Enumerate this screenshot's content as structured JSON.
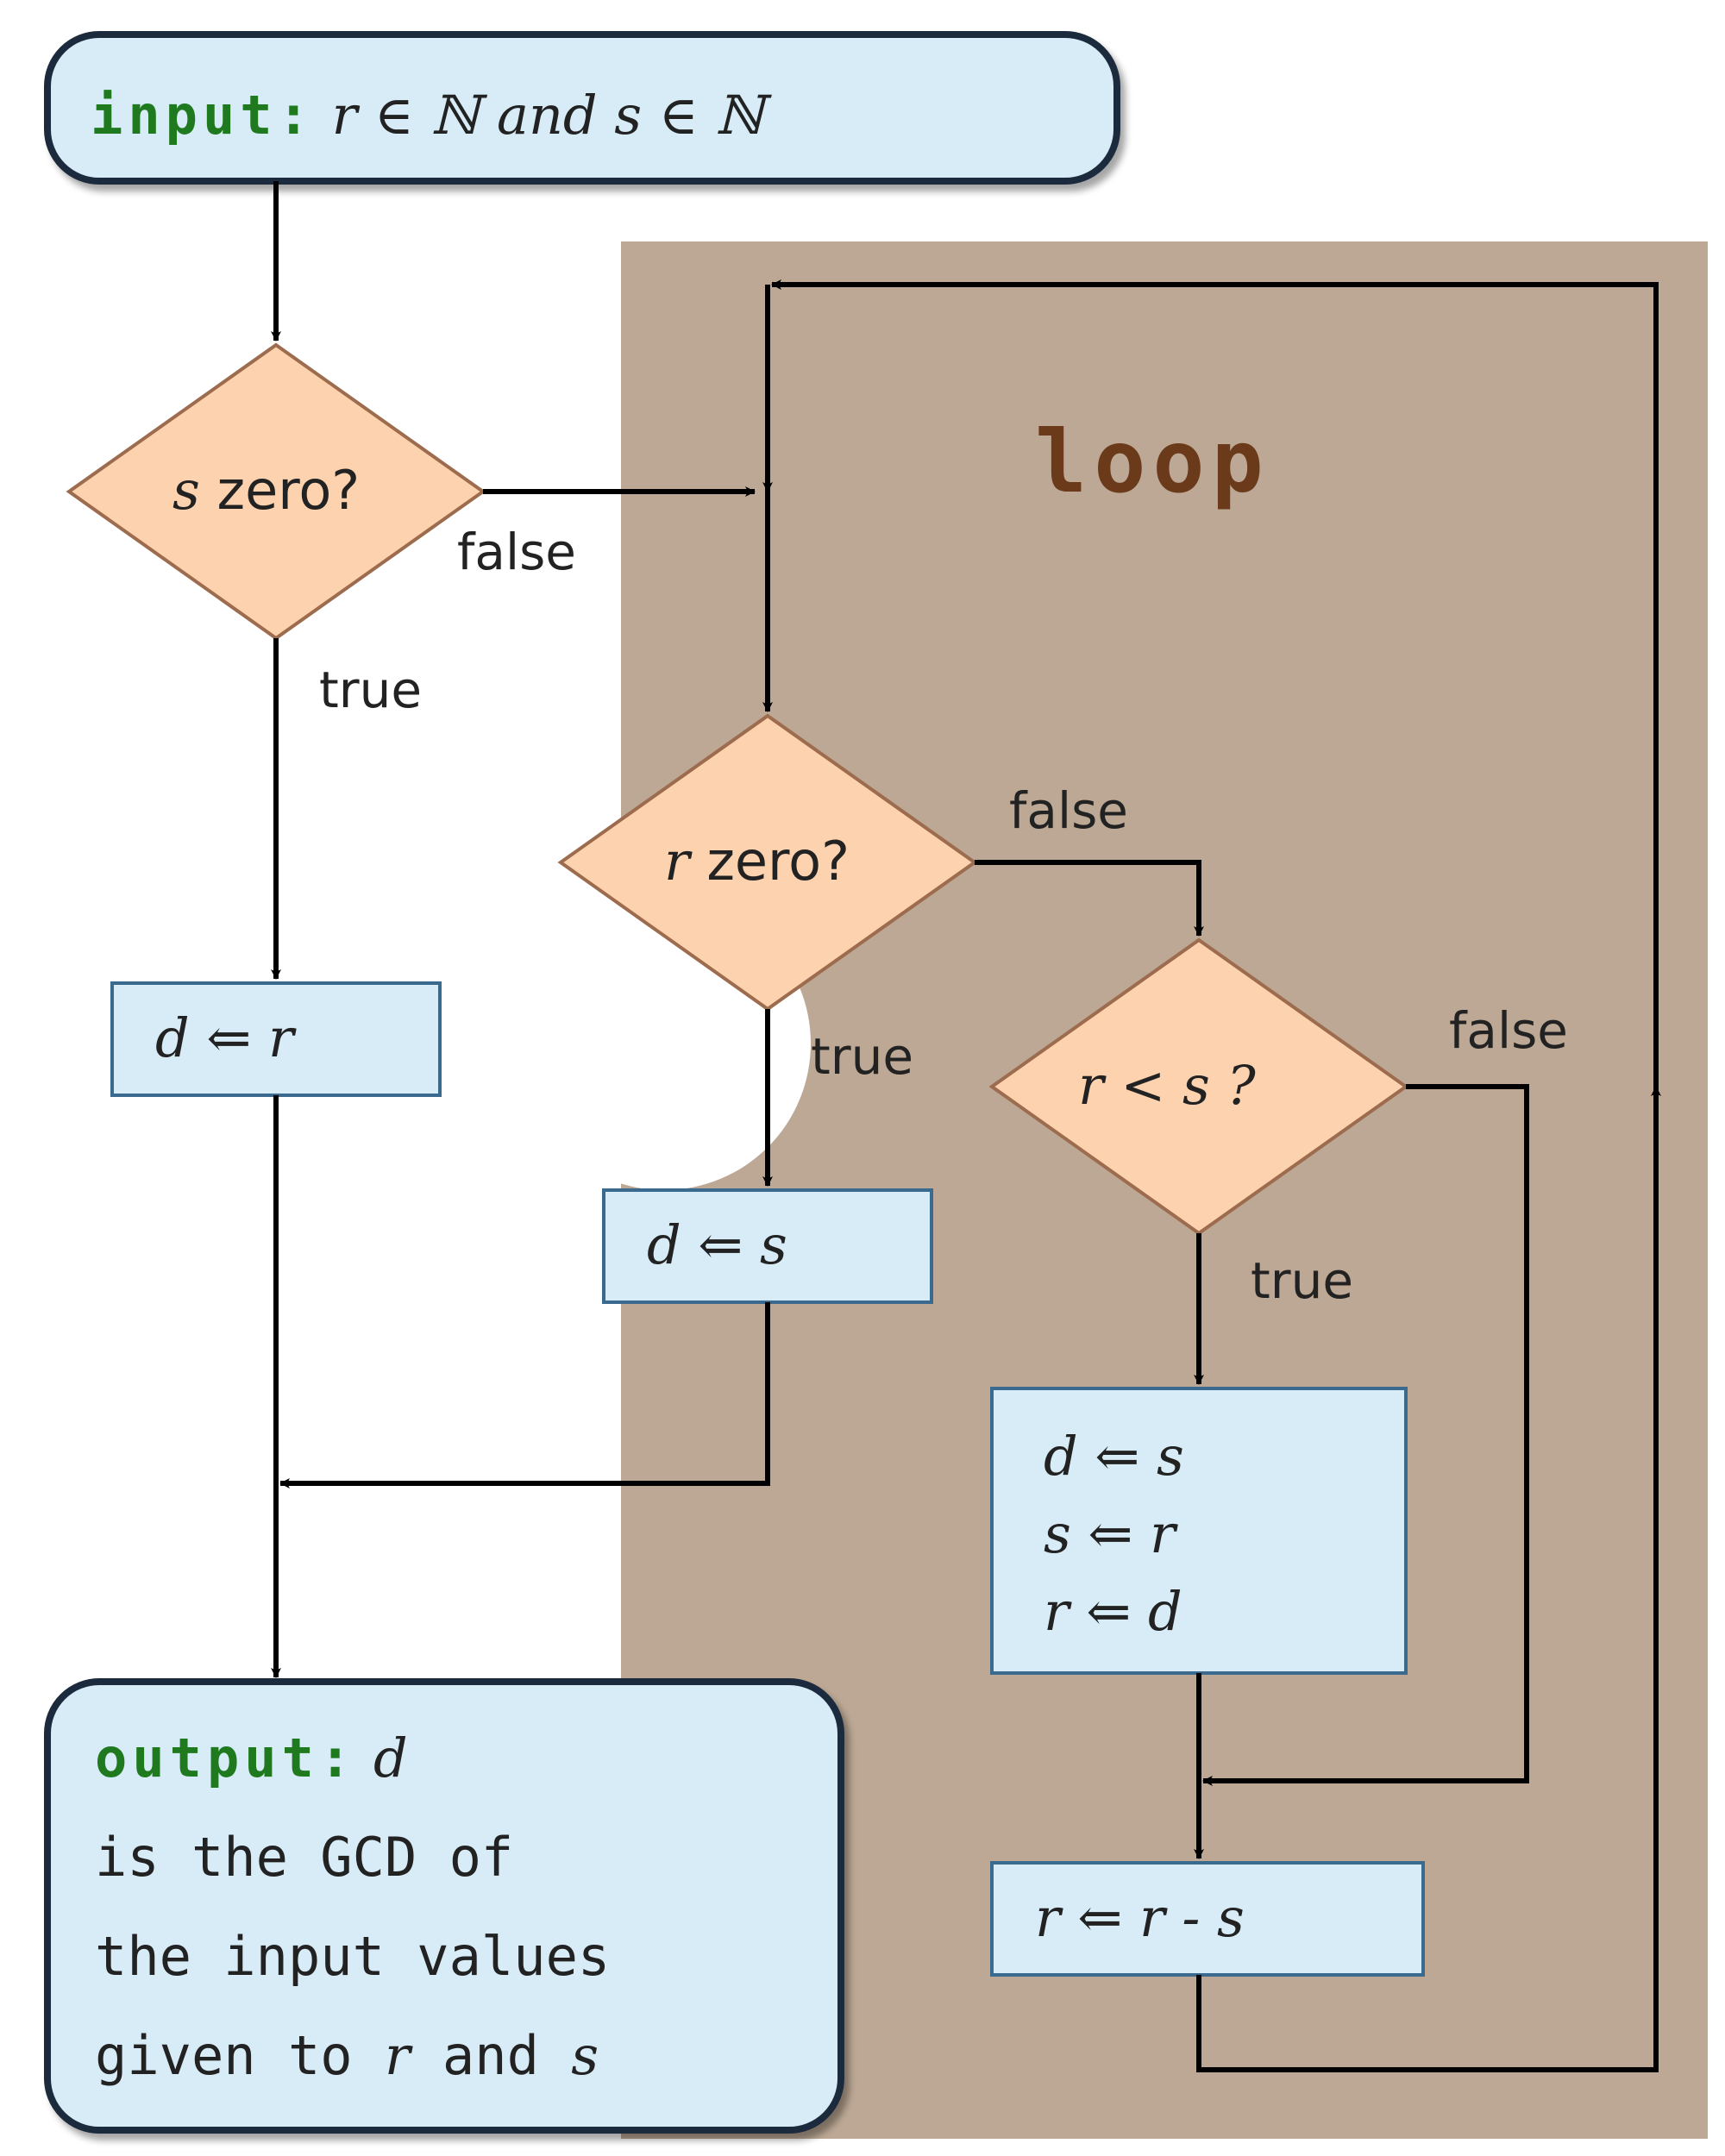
{
  "diagram": {
    "input": {
      "keyword": "input:",
      "text": " r ∈ ℕ  and  s ∈ ℕ"
    },
    "output": {
      "keyword": "output:",
      "var": " d",
      "line2": "is  the  GCD  of",
      "line3": "the  input  values",
      "line4": "given to  r  and  s"
    },
    "loop_label": "loop",
    "decisions": {
      "s_zero": {
        "text": "s zero?",
        "true": "true",
        "false": "false"
      },
      "r_zero": {
        "text": "r zero?",
        "true": "true",
        "false": "false"
      },
      "r_lt_s": {
        "text": "r < s ?",
        "true": "true",
        "false": "false"
      }
    },
    "processes": {
      "d_r": "d ⇐ r",
      "d_s": "d ⇐ s",
      "swap1": "d ⇐ s",
      "swap2": "s ⇐ r",
      "swap3": "r ⇐ d",
      "sub": "r ⇐ r - s"
    }
  },
  "colors": {
    "io_fill": "#d7ecf6",
    "proc_fill": "#d7ecf6",
    "diamond_fill": "#fcd2af",
    "loop_bg": "#bca894",
    "keyword": "#1f7a1f",
    "loop_label": "#6b3a1a"
  }
}
